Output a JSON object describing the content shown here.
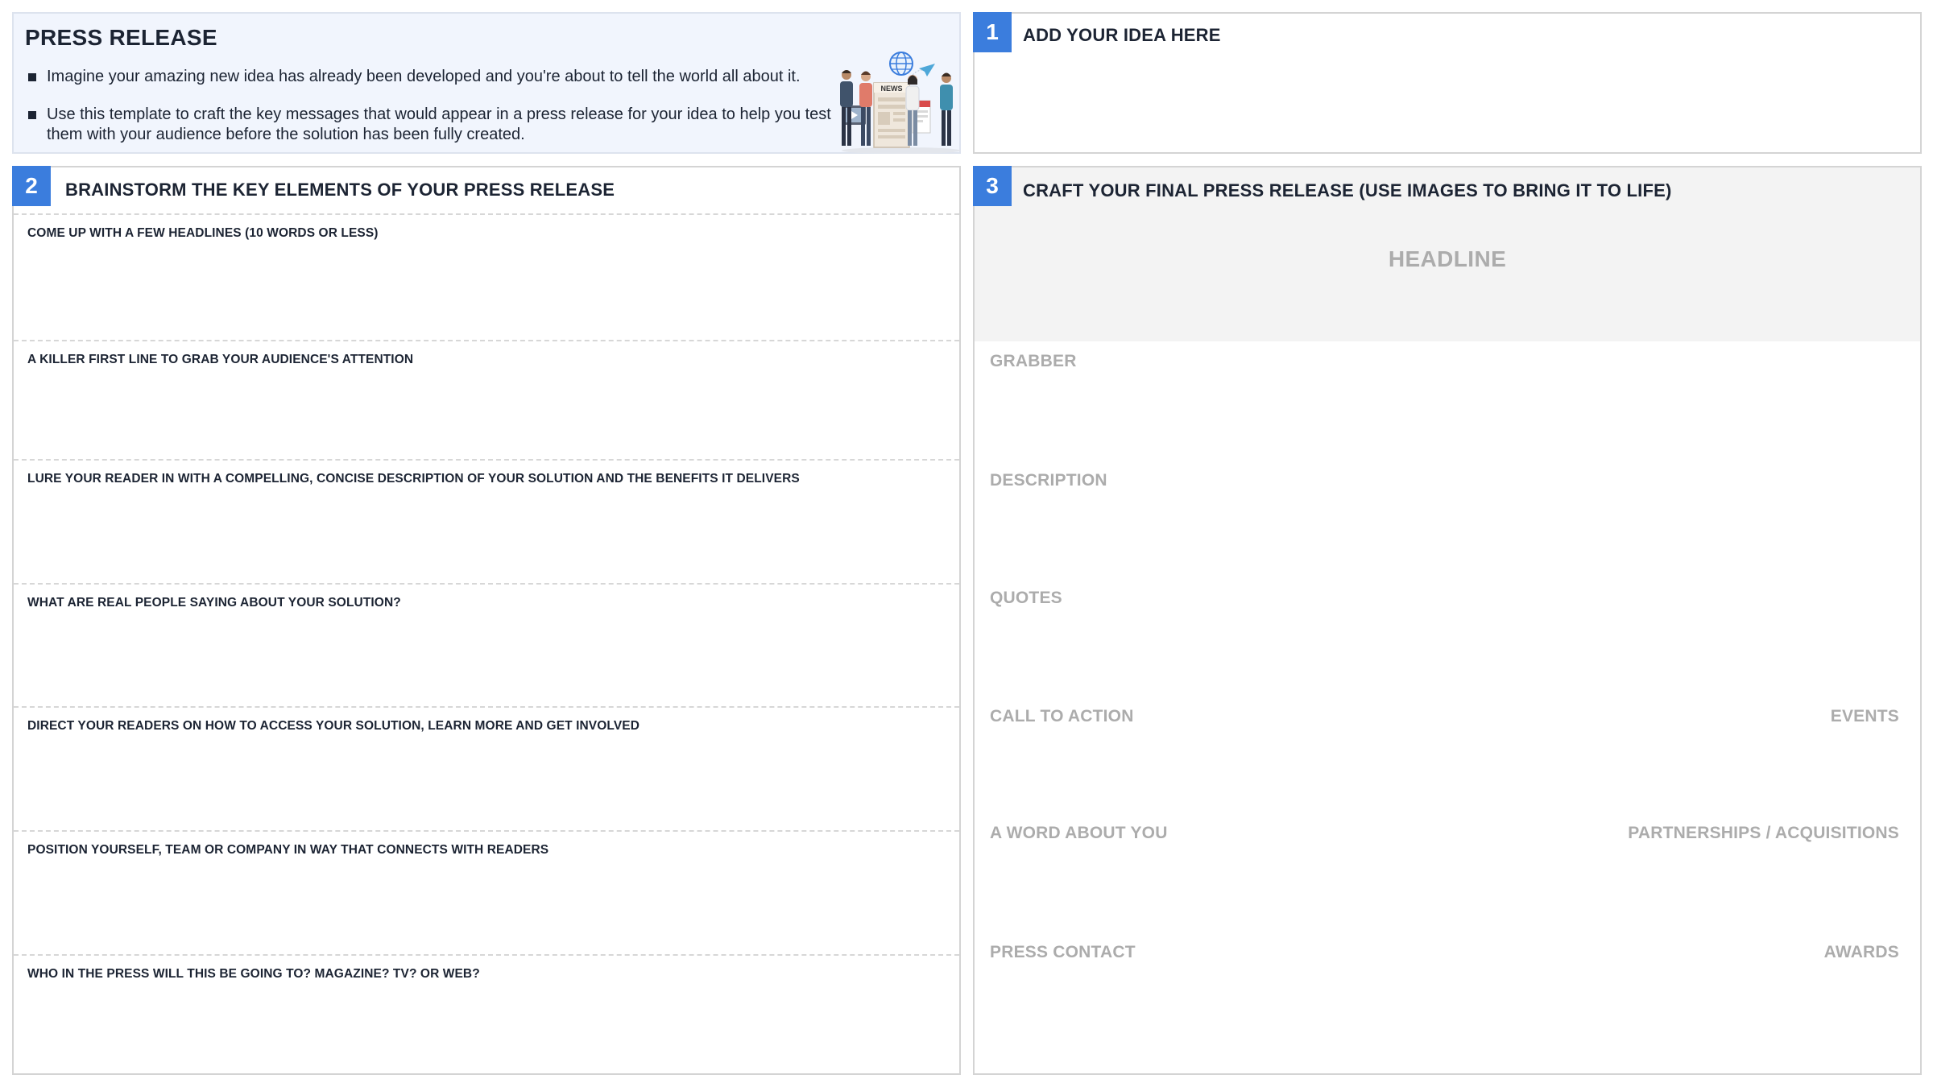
{
  "intro": {
    "title": "PRESS RELEASE",
    "bullets": [
      "Imagine your amazing new idea has already been developed and you're about to tell the world all about it.",
      "Use this template to craft the key messages that would appear in a press release for your idea to help you test them with your audience before the solution has been fully created."
    ],
    "illustration": {
      "icon": "news-people-illustration",
      "sign_text": "NEWS"
    }
  },
  "section_1": {
    "number": "1",
    "title": "ADD YOUR IDEA HERE"
  },
  "section_2": {
    "number": "2",
    "title": "BRAINSTORM THE KEY ELEMENTS OF YOUR PRESS RELEASE",
    "prompts": [
      "COME UP WITH A FEW HEADLINES (10 WORDS OR LESS)",
      "A KILLER FIRST LINE TO GRAB YOUR AUDIENCE'S ATTENTION",
      "LURE YOUR READER IN WITH A COMPELLING, CONCISE DESCRIPTION OF YOUR SOLUTION AND THE BENEFITS IT DELIVERS",
      "WHAT ARE REAL PEOPLE SAYING ABOUT YOUR SOLUTION?",
      "DIRECT YOUR READERS ON HOW TO ACCESS YOUR SOLUTION, LEARN MORE AND GET INVOLVED",
      "POSITION YOURSELF, TEAM OR COMPANY IN WAY THAT CONNECTS WITH READERS",
      "WHO IN THE PRESS WILL THIS BE GOING TO? MAGAZINE? TV? OR WEB?"
    ]
  },
  "section_3": {
    "number": "3",
    "title": "CRAFT YOUR FINAL PRESS RELEASE (USE IMAGES TO BRING IT TO LIFE)",
    "headline": "HEADLINE",
    "grabber": "GRABBER",
    "description": "DESCRIPTION",
    "quotes": "QUOTES",
    "call_to_action": "CALL TO ACTION",
    "events": "EVENTS",
    "a_word_about_you": "A WORD ABOUT YOU",
    "partnerships": "PARTNERSHIPS / ACQUISITIONS",
    "press_contact": "PRESS CONTACT",
    "awards": "AWARDS"
  },
  "colors": {
    "accent": "#3b7ddd",
    "intro_background": "#f1f5fd",
    "placeholder_text": "#acacac",
    "headline_background": "#f3f3f3"
  }
}
